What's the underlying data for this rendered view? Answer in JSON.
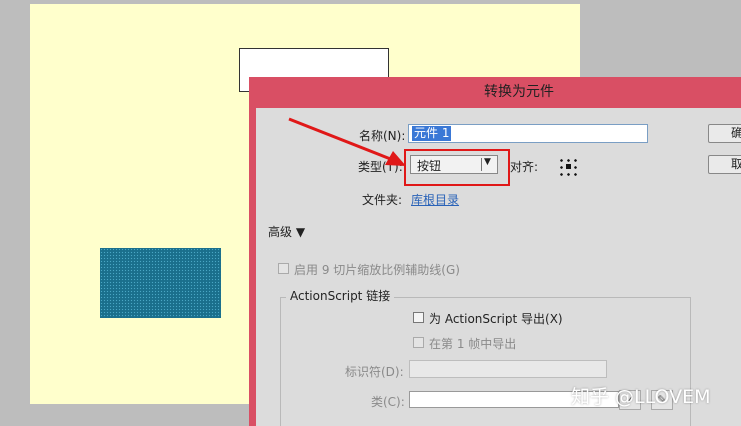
{
  "dialog": {
    "title": "转换为元件",
    "name_label": "名称(N):",
    "name_value": "元件 1",
    "type_label": "类型(T):",
    "type_value": "按钮",
    "align_label": "对齐:",
    "folder_label": "文件夹:",
    "folder_link": "库根目录",
    "advanced_label": "高级 ▼",
    "ok_button": "确定",
    "cancel_button": "取消",
    "enable_9slice": "启用 9 切片缩放比例辅助线(G)",
    "actionscript_group": "ActionScript 链接",
    "export_for_as": "为 ActionScript 导出(X)",
    "export_in_frame1": "在第 1 帧中导出",
    "identifier_label": "标识符(D):",
    "class_label": "类(C):"
  },
  "annotation": {
    "arrow_color": "#e01818",
    "highlight_color": "#e01818"
  },
  "watermark": "知乎 @LLOVEM",
  "colors": {
    "stage": "#ffffcc",
    "dialog_titlebar": "#d94f64",
    "dialog_body": "#dcdcdc",
    "selected_shape": "#1a6f8c"
  }
}
